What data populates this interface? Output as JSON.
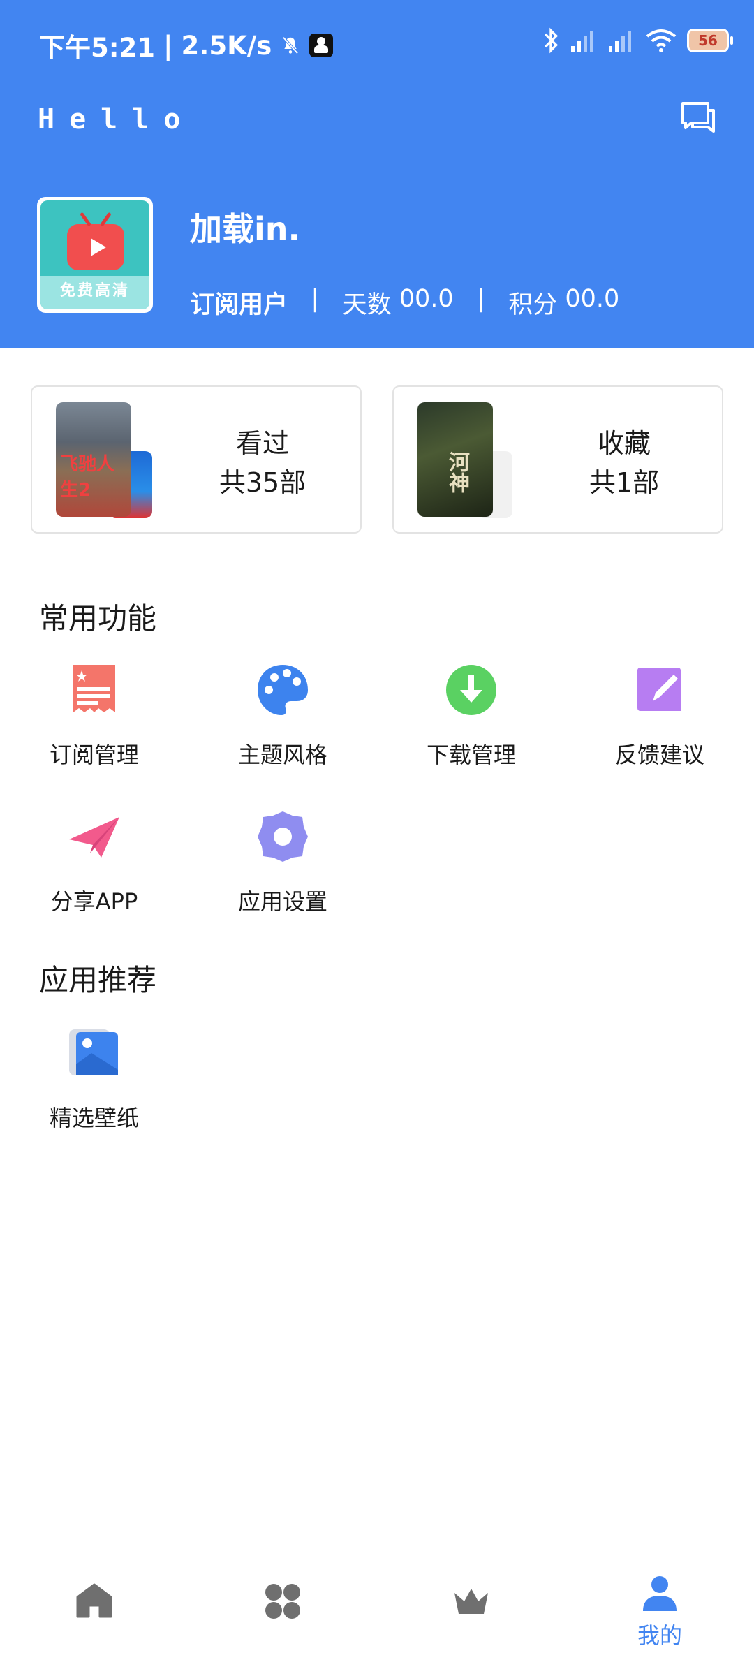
{
  "status_bar": {
    "time": "下午5:21",
    "network_speed": "2.5K/s",
    "battery": "56"
  },
  "header": {
    "title": "Hello",
    "avatar_badge_text": "免费高清",
    "username": "加载in.",
    "user_type": "订阅用户",
    "days_label": "天数",
    "days_value": "00.0",
    "points_label": "积分",
    "points_value": "00.0"
  },
  "cards": {
    "watched": {
      "title": "看过",
      "count": "共35部",
      "poster_text": "飞驰人生2"
    },
    "favorites": {
      "title": "收藏",
      "count": "共1部",
      "poster_text": "河神"
    }
  },
  "common_functions": {
    "title": "常用功能",
    "items": [
      {
        "label": "订阅管理",
        "icon": "subscription-icon",
        "color": "#f4756a"
      },
      {
        "label": "主题风格",
        "icon": "palette-icon",
        "color": "#3d83ee"
      },
      {
        "label": "下载管理",
        "icon": "download-icon",
        "color": "#5ad162"
      },
      {
        "label": "反馈建议",
        "icon": "edit-icon",
        "color": "#b77df2"
      },
      {
        "label": "分享APP",
        "icon": "paper-plane-icon",
        "color": "#f25a8c"
      },
      {
        "label": "应用设置",
        "icon": "gear-icon",
        "color": "#8f8df0"
      }
    ]
  },
  "recommend": {
    "title": "应用推荐",
    "items": [
      {
        "label": "精选壁纸",
        "icon": "wallpaper-icon",
        "color": "#3d83ee"
      }
    ]
  },
  "bottom_nav": {
    "items": [
      {
        "icon": "home-icon"
      },
      {
        "icon": "grid-icon"
      },
      {
        "icon": "crown-icon"
      },
      {
        "icon": "person-icon",
        "label": "我的",
        "active": true
      }
    ]
  },
  "colors": {
    "primary": "#4285f1",
    "nav_inactive": "#6f6f6f"
  }
}
